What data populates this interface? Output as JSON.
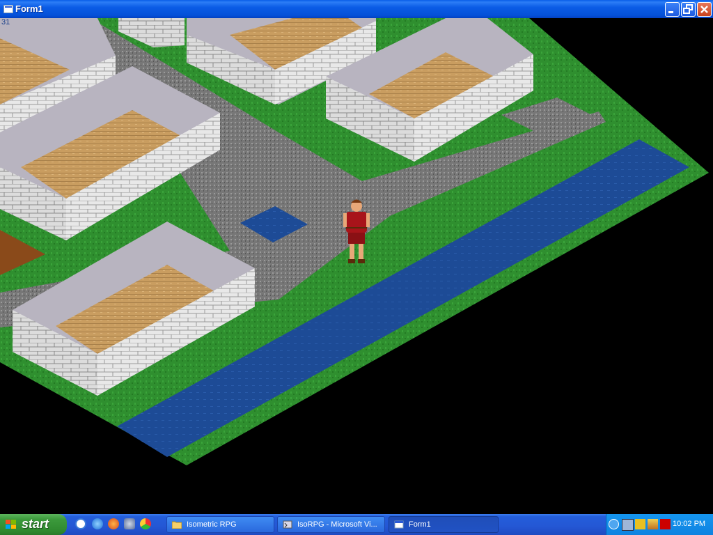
{
  "window": {
    "title": "Form1",
    "minimize_label": "",
    "maximize_label": "",
    "close_label": ""
  },
  "game": {
    "fps": "31"
  },
  "taskbar": {
    "start_label": "start",
    "quick_launch": [
      "internet-explorer-icon",
      "ie-browser-icon",
      "firefox-icon",
      "media-icon",
      "chrome-icon"
    ],
    "tasks": [
      {
        "label": "Isometric RPG",
        "icon": "folder-icon"
      },
      {
        "label": "IsoRPG - Microsoft Vi...",
        "icon": "visual-studio-icon"
      },
      {
        "label": "Form1",
        "icon": "form-window-icon"
      }
    ],
    "tray_icons": [
      "network-icon",
      "zonealarm-icon",
      "security-icon",
      "ati-icon"
    ],
    "clock": "10:02 PM"
  },
  "colors": {
    "titlebar": "#0b5ce6",
    "grass": "#2e8b2e",
    "water": "#1f4f9a",
    "road": "#7a7a7a",
    "wall": "#d8d8d8",
    "wood": "#c69a5c",
    "taskbar": "#245edb",
    "start": "#3c9a3c"
  }
}
